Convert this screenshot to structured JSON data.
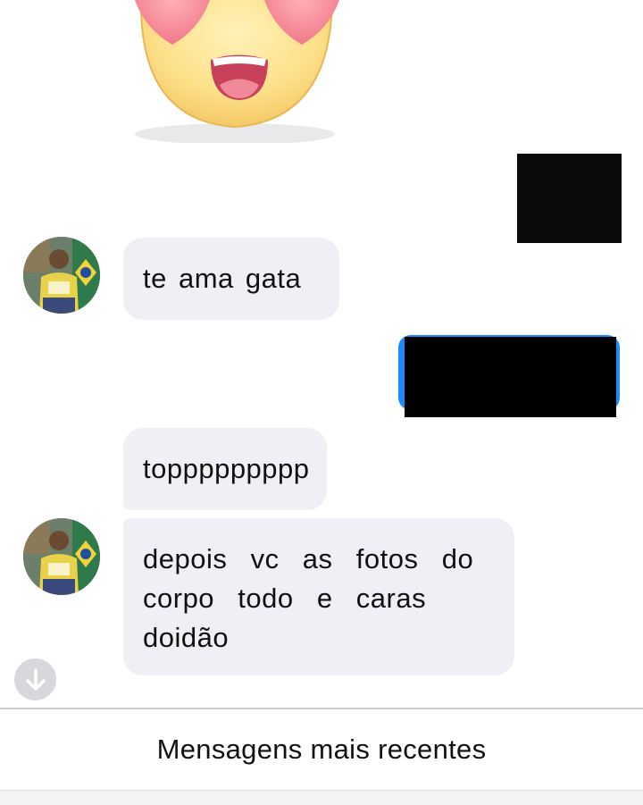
{
  "conversation": {
    "messages": [
      {
        "sender": "contact",
        "text": "te ama gata"
      },
      {
        "sender": "contact",
        "text": "toppppppppp"
      },
      {
        "sender": "contact",
        "text_lines": [
          "depois  vc  as  fotos  do",
          "corpo  todo  e  caras",
          "doidão"
        ]
      }
    ],
    "sticker": {
      "icon": "heart-eyes-face-icon"
    }
  },
  "footer": {
    "recent_messages_label": "Mensagens mais recentes"
  },
  "controls": {
    "scroll_down_icon": "arrow-down-icon"
  },
  "colors": {
    "bubble_received": "#eef0f5",
    "sent_accent": "#1a8cff",
    "redaction": "#000000"
  }
}
